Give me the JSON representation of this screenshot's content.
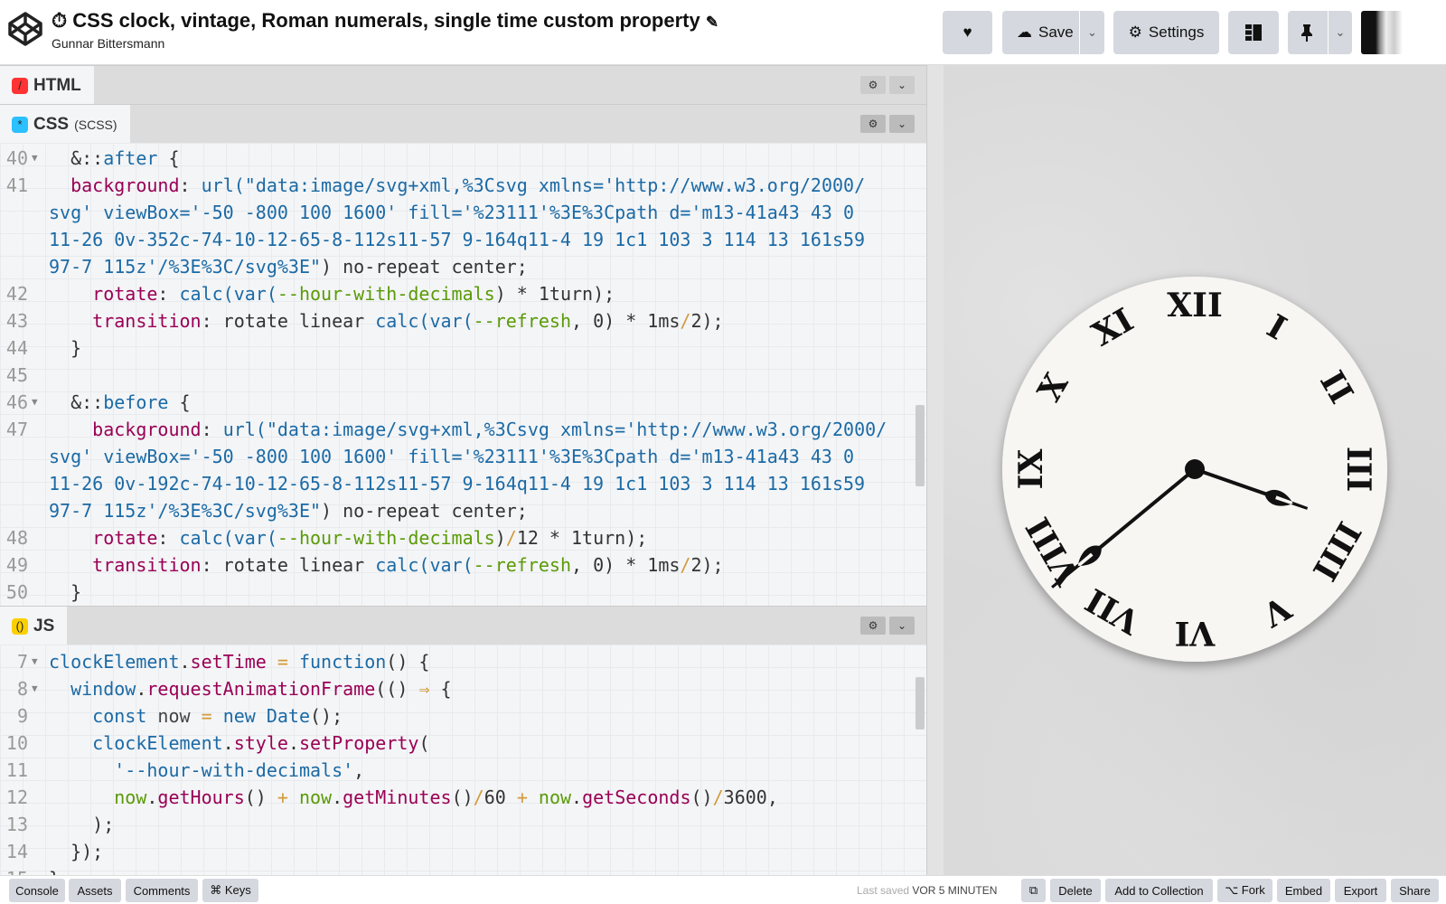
{
  "header": {
    "title": "CSS clock, vintage, Roman numerals, single time custom property",
    "title_icon": "stopwatch-icon",
    "author": "Gunnar Bittersmann",
    "buttons": {
      "love": "heart-icon",
      "save": "Save",
      "settings": "Settings",
      "layout": "layout-icon",
      "pin": "pin-icon"
    }
  },
  "panels": {
    "html": {
      "label": "HTML"
    },
    "css": {
      "label": "CSS",
      "sub": "(SCSS)",
      "lines": [
        {
          "n": "40",
          "fold": true,
          "t": [
            [
              "t",
              "  &::"
            ],
            [
              "b",
              "after"
            ],
            [
              "t",
              " {"
            ]
          ]
        },
        {
          "n": "41",
          "t": [
            [
              "t",
              "  "
            ],
            [
              "p",
              "background"
            ],
            [
              "t",
              ": "
            ],
            [
              "b",
              "url(\"data:image/svg+xml,%3Csvg xmlns='http://www.w3.org/2000/"
            ]
          ]
        },
        {
          "n": "",
          "t": [
            [
              "b",
              "svg' viewBox='-50 -800 100 1600' fill='%23111'%3E%3Cpath d='m13-41a43 43 0"
            ]
          ]
        },
        {
          "n": "",
          "t": [
            [
              "b",
              "11-26 0v-352c-74-10-12-65-8-112s11-57 9-164q11-4 19 1c1 103 3 114 13 161s59"
            ]
          ]
        },
        {
          "n": "",
          "t": [
            [
              "b",
              "97-7 115z'/%3E%3C/svg%3E\""
            ],
            [
              "t",
              ") no-repeat center;"
            ]
          ]
        },
        {
          "n": "42",
          "t": [
            [
              "t",
              "    "
            ],
            [
              "p",
              "rotate"
            ],
            [
              "t",
              ": "
            ],
            [
              "b",
              "calc(var("
            ],
            [
              "g",
              "--hour-with-decimals"
            ],
            [
              "t",
              ") * 1turn);"
            ]
          ]
        },
        {
          "n": "43",
          "t": [
            [
              "t",
              "    "
            ],
            [
              "p",
              "transition"
            ],
            [
              "t",
              ": rotate linear "
            ],
            [
              "b",
              "calc(var("
            ],
            [
              "g",
              "--refresh"
            ],
            [
              "t",
              ", 0) * 1ms"
            ],
            [
              "o",
              "/"
            ],
            [
              "t",
              "2);"
            ]
          ]
        },
        {
          "n": "44",
          "t": [
            [
              "t",
              "  }"
            ]
          ]
        },
        {
          "n": "45",
          "t": []
        },
        {
          "n": "46",
          "fold": true,
          "t": [
            [
              "t",
              "  &::"
            ],
            [
              "b",
              "before"
            ],
            [
              "t",
              " {"
            ]
          ]
        },
        {
          "n": "47",
          "t": [
            [
              "t",
              "    "
            ],
            [
              "p",
              "background"
            ],
            [
              "t",
              ": "
            ],
            [
              "b",
              "url(\"data:image/svg+xml,%3Csvg xmlns='http://www.w3.org/2000/"
            ]
          ]
        },
        {
          "n": "",
          "t": [
            [
              "b",
              "svg' viewBox='-50 -800 100 1600' fill='%23111'%3E%3Cpath d='m13-41a43 43 0"
            ]
          ]
        },
        {
          "n": "",
          "t": [
            [
              "b",
              "11-26 0v-192c-74-10-12-65-8-112s11-57 9-164q11-4 19 1c1 103 3 114 13 161s59"
            ]
          ]
        },
        {
          "n": "",
          "t": [
            [
              "b",
              "97-7 115z'/%3E%3C/svg%3E\""
            ],
            [
              "t",
              ") no-repeat center;"
            ]
          ]
        },
        {
          "n": "48",
          "t": [
            [
              "t",
              "    "
            ],
            [
              "p",
              "rotate"
            ],
            [
              "t",
              ": "
            ],
            [
              "b",
              "calc(var("
            ],
            [
              "g",
              "--hour-with-decimals"
            ],
            [
              "t",
              ")"
            ],
            [
              "o",
              "/"
            ],
            [
              "t",
              "12 * 1turn);"
            ]
          ]
        },
        {
          "n": "49",
          "t": [
            [
              "t",
              "    "
            ],
            [
              "p",
              "transition"
            ],
            [
              "t",
              ": rotate linear "
            ],
            [
              "b",
              "calc(var("
            ],
            [
              "g",
              "--refresh"
            ],
            [
              "t",
              ", 0) * 1ms"
            ],
            [
              "o",
              "/"
            ],
            [
              "t",
              "2);"
            ]
          ]
        },
        {
          "n": "50",
          "t": [
            [
              "t",
              "  }"
            ]
          ]
        }
      ]
    },
    "js": {
      "label": "JS",
      "lines": [
        {
          "n": "7",
          "fold": true,
          "t": [
            [
              "b",
              "clockElement"
            ],
            [
              "t",
              "."
            ],
            [
              "p",
              "setTime"
            ],
            [
              "o",
              " = "
            ],
            [
              "b",
              "function"
            ],
            [
              "t",
              "() {"
            ]
          ]
        },
        {
          "n": "8",
          "fold": true,
          "t": [
            [
              "t",
              "  "
            ],
            [
              "b",
              "window"
            ],
            [
              "t",
              "."
            ],
            [
              "p",
              "requestAnimationFrame"
            ],
            [
              "t",
              "(() "
            ],
            [
              "o",
              "⇒"
            ],
            [
              "t",
              " {"
            ]
          ]
        },
        {
          "n": "9",
          "t": [
            [
              "t",
              "    "
            ],
            [
              "b",
              "const"
            ],
            [
              "n",
              " now"
            ],
            [
              "o",
              " = "
            ],
            [
              "b",
              "new Date"
            ],
            [
              "t",
              "();"
            ]
          ]
        },
        {
          "n": "10",
          "t": [
            [
              "t",
              "    "
            ],
            [
              "b",
              "clockElement"
            ],
            [
              "t",
              "."
            ],
            [
              "p",
              "style"
            ],
            [
              "t",
              "."
            ],
            [
              "p",
              "setProperty"
            ],
            [
              "t",
              "("
            ]
          ]
        },
        {
          "n": "11",
          "t": [
            [
              "t",
              "      "
            ],
            [
              "b",
              "'--hour-with-decimals'"
            ],
            [
              "t",
              ","
            ]
          ]
        },
        {
          "n": "12",
          "t": [
            [
              "t",
              "      "
            ],
            [
              "g",
              "now"
            ],
            [
              "t",
              "."
            ],
            [
              "p",
              "getHours"
            ],
            [
              "t",
              "() "
            ],
            [
              "o",
              "+"
            ],
            [
              "t",
              " "
            ],
            [
              "g",
              "now"
            ],
            [
              "t",
              "."
            ],
            [
              "p",
              "getMinutes"
            ],
            [
              "t",
              "()"
            ],
            [
              "o",
              "/"
            ],
            [
              "t",
              "60 "
            ],
            [
              "o",
              "+"
            ],
            [
              "t",
              " "
            ],
            [
              "g",
              "now"
            ],
            [
              "t",
              "."
            ],
            [
              "p",
              "getSeconds"
            ],
            [
              "t",
              "()"
            ],
            [
              "o",
              "/"
            ],
            [
              "t",
              "3600,"
            ]
          ]
        },
        {
          "n": "13",
          "t": [
            [
              "t",
              "    );"
            ]
          ]
        },
        {
          "n": "14",
          "t": [
            [
              "t",
              "  });"
            ]
          ]
        },
        {
          "n": "15",
          "t": [
            [
              "t",
              "}"
            ]
          ]
        }
      ]
    }
  },
  "clock": {
    "numerals": [
      "XII",
      "I",
      "II",
      "III",
      "IIII",
      "V",
      "VI",
      "VII",
      "VIII",
      "IX",
      "X",
      "XI"
    ],
    "hour_with_decimals": 3.64,
    "face_color": "#f7f6f3",
    "hand_color": "#111111"
  },
  "footer": {
    "left": [
      "Console",
      "Assets",
      "Comments",
      "⌘ Keys"
    ],
    "saved_label": "Last saved",
    "saved_time": "VOR 5 MINUTEN",
    "right": [
      "Delete",
      "Add to Collection",
      "⌥ Fork",
      "Embed",
      "Export",
      "Share"
    ]
  }
}
